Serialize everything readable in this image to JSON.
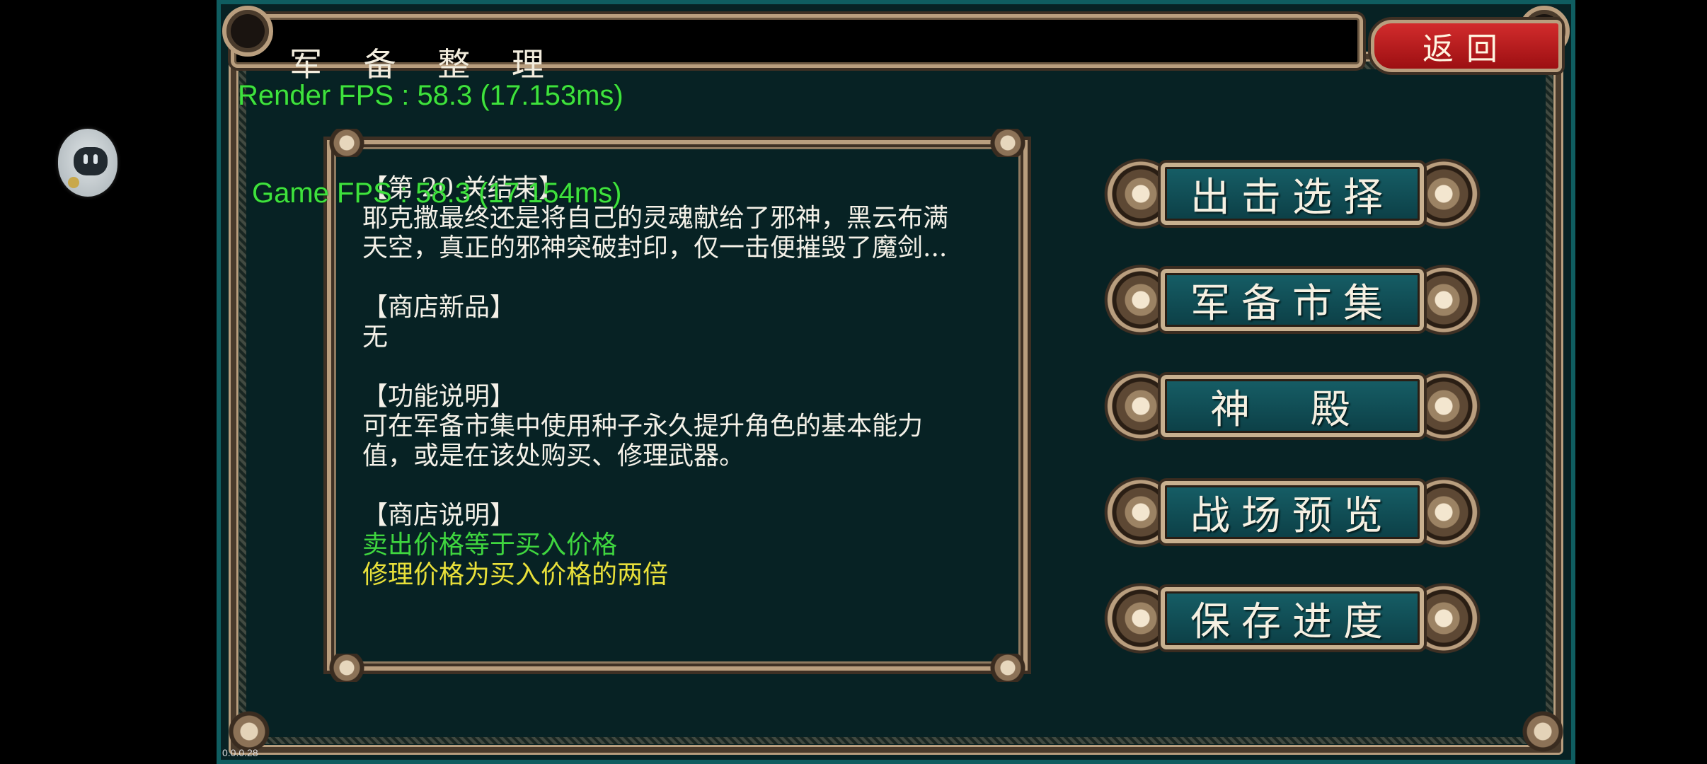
{
  "overlay": {
    "render_fps": "Render FPS : 58.3 (17.153ms)",
    "game_fps": "Game FPS : 58.3 (17.154ms)"
  },
  "header": {
    "title": "军 备 整 理",
    "back_label": "返回"
  },
  "info": {
    "stage_heading": "【第 20 关结束】",
    "stage_text_1": "耶克撒最终还是将自己的灵魂献给了邪神，黑云布满",
    "stage_text_2": "天空，真正的邪神突破封印，仅一击便摧毁了魔剑...",
    "new_items_heading": "【商店新品】",
    "new_items_text": "无",
    "function_heading": "【功能说明】",
    "function_text_1": "可在军备市集中使用种子永久提升角色的基本能力",
    "function_text_2": "值，或是在该处购买、修理武器。",
    "shop_heading": "【商店说明】",
    "shop_line_green": "卖出价格等于买入价格",
    "shop_line_yellow": "修理价格为买入价格的两倍"
  },
  "menu": {
    "sortie": "出击选择",
    "market": "军备市集",
    "temple": "神 殿",
    "preview": "战场预览",
    "save": "保存进度"
  },
  "version": "0.0.0.28",
  "colors": {
    "background": "#072224",
    "frame_gold": "#b99e7e",
    "button_teal": "#165e66",
    "back_red": "#c01e20",
    "text_green": "#3fd63f",
    "text_yellow": "#e8e03a",
    "fps_green": "#3ee23e"
  }
}
